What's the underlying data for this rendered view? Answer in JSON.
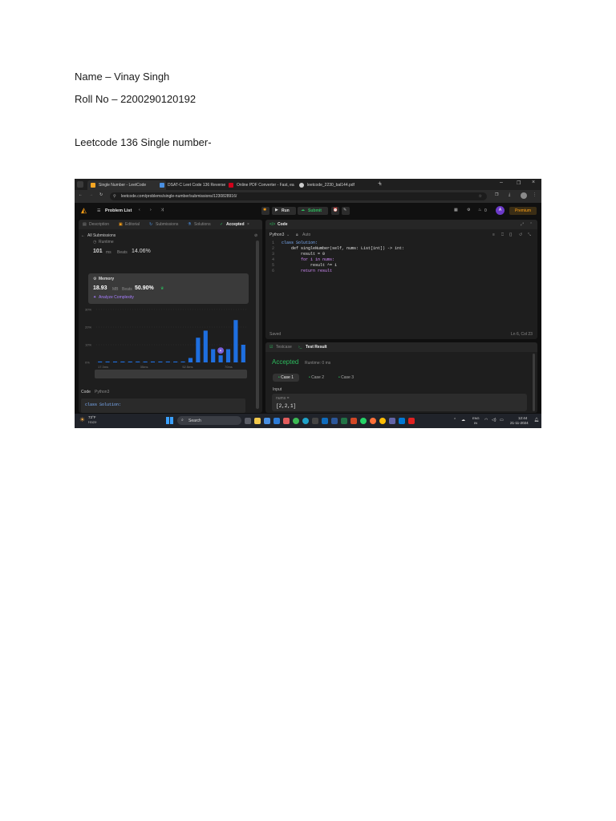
{
  "document": {
    "name_line": "Name – Vinay Singh",
    "roll_line": "Roll No – 2200290120192",
    "heading": "Leetcode 136 Single number-"
  },
  "browser": {
    "tabs": [
      {
        "label": "Single Number - LeetCode",
        "color": "#f5a623"
      },
      {
        "label": "DSAT-C Leet Code 136 Reverse",
        "color": "#4a90e2"
      },
      {
        "label": "Online PDF Converter - Fast, ea",
        "color": "#d0021b"
      },
      {
        "label": "leetcode_2230_bal144.pdf",
        "color": "#cccccc"
      }
    ],
    "url": "leetcode.com/problems/single-number/submissions/1230828916/"
  },
  "leetcode": {
    "problem_list": "Problem List",
    "run": "Run",
    "submit": "Submit",
    "premium": "Premium",
    "avatar": "A",
    "count": "0",
    "left_tabs": [
      "Description",
      "Editorial",
      "Submissions",
      "Solutions",
      "Accepted"
    ],
    "all_submissions": "All Submissions",
    "runtime_label": "Runtime",
    "runtime_value": "101",
    "runtime_unit": "ms",
    "runtime_beats_label": "Beats",
    "runtime_beats": "14.06%",
    "memory_label": "Memory",
    "memory_value": "18.93",
    "memory_unit": "MB",
    "memory_beats_label": "Beats",
    "memory_beats": "50.90%",
    "analyze": "Analyze Complexity",
    "code_label": "Code",
    "code_lang": "Python3",
    "code_preview": "class Solution:",
    "editor_title": "Code",
    "editor_lang": "Python3",
    "editor_auto": "Auto",
    "code_lines": [
      "class Solution:",
      "    def singleNumber(self, nums: List[int]) -> int:",
      "        result = 0",
      "        for i in nums:",
      "            result ^= i",
      "        return result"
    ],
    "saved": "Saved",
    "cursor": "Ln 6, Col 23",
    "testcase_tab": "Testcase",
    "test_result_tab": "Test Result",
    "accepted": "Accepted",
    "result_runtime": "Runtime: 0 ms",
    "cases": [
      "Case 1",
      "Case 2",
      "Case 3"
    ],
    "input_label": "Input",
    "nums_label": "nums =",
    "nums_value": "[2,2,1]"
  },
  "chart_data": {
    "type": "bar",
    "yticks": [
      "30%",
      "20%",
      "10%",
      "0%"
    ],
    "xticks": [
      "17.3ms",
      "35ms",
      "52.5ms",
      "70ms"
    ],
    "values": [
      0.5,
      0.5,
      0.5,
      0.5,
      0.5,
      0.5,
      0.5,
      0.5,
      0.5,
      0.5,
      0.5,
      0.5,
      2.5,
      14,
      18,
      7.5,
      4,
      7.5,
      24,
      10
    ],
    "ylim": [
      0,
      30
    ],
    "highlight_index": 16,
    "color": "#1e6fe0"
  },
  "taskbar": {
    "weather_temp": "73°F",
    "weather_desc": "Haze",
    "search": "Search",
    "lang": "ENG",
    "region": "IN",
    "time": "12:44",
    "date": "21-11-2024"
  }
}
